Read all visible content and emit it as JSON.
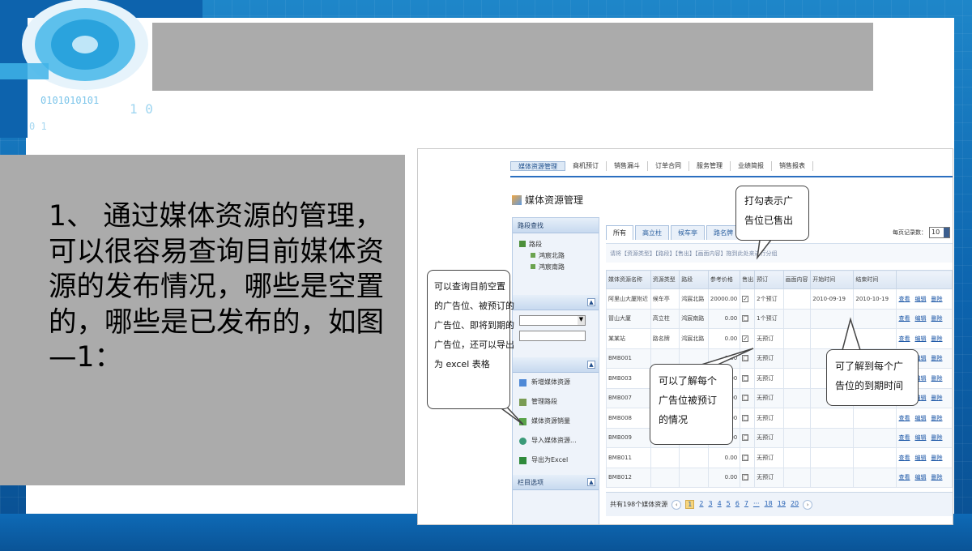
{
  "slide": {
    "body_text": "1、 通过媒体资源的管理，可以很容易查询目前媒体资源的发布情况，哪些是空置的，哪些是已发布的，如图—1："
  },
  "app": {
    "top_nav": [
      "媒体资源管理",
      "商机预订",
      "销售漏斗",
      "订单合同",
      "服务管理",
      "业绩简报",
      "销售报表"
    ],
    "title": "媒体资源管理",
    "sidebar": {
      "section1_title": "路段查找",
      "tree": [
        "路段",
        "鸿宸北路",
        "鸿宸南路"
      ],
      "menu": [
        "新增媒体资源",
        "管理路段",
        "媒体资源销量",
        "导入媒体资源...",
        "导出为Excel"
      ],
      "section_bottom": "栏目选项"
    },
    "tabs": [
      "所有",
      "高立柱",
      "候车亭",
      "路名牌"
    ],
    "per_page_label": "每页记录数：",
    "per_page_value": "10",
    "filter_line": "请将【资源类型】【路段】【售出】【画面内容】拖到此处来进行分组",
    "table": {
      "headers": [
        "媒体资源名称",
        "资源类型",
        "路段",
        "参考价格",
        "售出",
        "预订",
        "画面内容",
        "开始时间",
        "结束时间",
        ""
      ],
      "rows": [
        [
          "阿里山大厦附近",
          "候车亭",
          "鸿宸北路",
          "20000.00",
          "✓",
          "2个预订",
          "",
          "2010-09-19",
          "2010-10-19"
        ],
        [
          "冒山大厦",
          "高立柱",
          "鸿宸南路",
          "0.00",
          "□",
          "1个预订",
          "",
          "",
          ""
        ],
        [
          "某某站",
          "路名牌",
          "鸿宸北路",
          "0.00",
          "✓",
          "无预订",
          "",
          "",
          ""
        ],
        [
          "BMB001",
          "",
          "",
          "0.00",
          "□",
          "无预订",
          "",
          "",
          ""
        ],
        [
          "BMB003",
          "",
          "",
          "0.00",
          "□",
          "无预订",
          "",
          "",
          ""
        ],
        [
          "BMB007",
          "",
          "",
          "0.00",
          "□",
          "无预订",
          "",
          "",
          ""
        ],
        [
          "BMB008",
          "",
          "",
          "0.00",
          "□",
          "无预订",
          "",
          "",
          ""
        ],
        [
          "BMB009",
          "",
          "",
          "0.00",
          "□",
          "无预订",
          "",
          "",
          ""
        ],
        [
          "BMB011",
          "",
          "",
          "0.00",
          "□",
          "无预订",
          "",
          "",
          ""
        ],
        [
          "BMB012",
          "",
          "",
          "0.00",
          "□",
          "无预订",
          "",
          "",
          ""
        ]
      ],
      "row_actions": [
        "查看",
        "编辑",
        "删除"
      ]
    },
    "pager": {
      "total_text": "共有198个媒体资源",
      "pages": [
        "1",
        "2",
        "3",
        "4",
        "5",
        "6",
        "7",
        "···",
        "18",
        "19",
        "20"
      ]
    }
  },
  "callouts": {
    "sold": [
      "打勾表示广",
      "告位已售出"
    ],
    "query": [
      "可以查询目前空置",
      "的广告位、被预订的",
      "广告位、即将到期的",
      "广告位，还可以导出",
      "为 excel 表格"
    ],
    "reserved": [
      "可以了解每个",
      "广告位被预订",
      "的情况"
    ],
    "expiry": [
      "可了解到每个广",
      "告位的到期时间"
    ]
  }
}
